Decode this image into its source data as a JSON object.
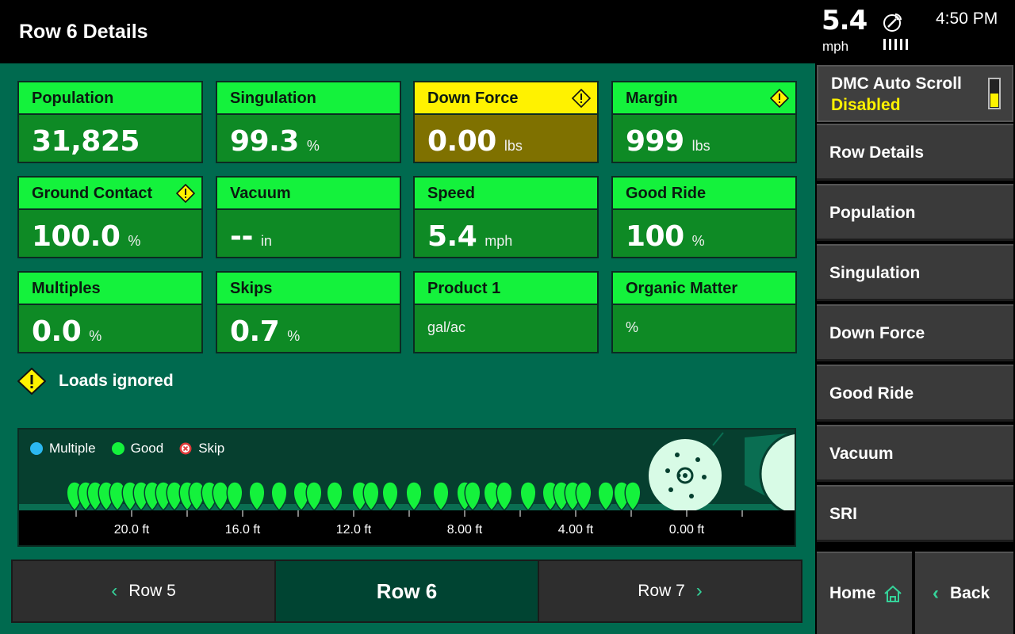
{
  "header": {
    "title": "Row 6 Details",
    "speed_value": "5.4",
    "speed_unit": "mph",
    "gps_icon": "gps-satellite-icon",
    "time": "4:50 PM"
  },
  "tiles": [
    {
      "label": "Population",
      "value": "31,825",
      "unit": "",
      "warning": false
    },
    {
      "label": "Singulation",
      "value": "99.3",
      "unit": "%",
      "warning": false
    },
    {
      "label": "Down Force",
      "value": "0.00",
      "unit": "lbs",
      "warning": true
    },
    {
      "label": "Margin",
      "value": "999",
      "unit": "lbs",
      "warning": false,
      "alert_icon": true
    },
    {
      "label": "Ground Contact",
      "value": "100.0",
      "unit": "%",
      "warning": false,
      "alert_icon": true
    },
    {
      "label": "Vacuum",
      "value": "--",
      "unit": "in",
      "warning": false
    },
    {
      "label": "Speed",
      "value": "5.4",
      "unit": "mph",
      "warning": false
    },
    {
      "label": "Good Ride",
      "value": "100",
      "unit": "%",
      "warning": false
    },
    {
      "label": "Multiples",
      "value": "0.0",
      "unit": "%",
      "warning": false
    },
    {
      "label": "Skips",
      "value": "0.7",
      "unit": "%",
      "warning": false
    },
    {
      "label": "Product 1",
      "value": "",
      "unit": "gal/ac",
      "warning": false
    },
    {
      "label": "Organic Matter",
      "value": "",
      "unit": "%",
      "warning": false
    }
  ],
  "alert": {
    "text": "Loads ignored",
    "icon": "warning-icon"
  },
  "seed_view": {
    "legend": [
      {
        "label": "Multiple",
        "color": "#2bb8f0"
      },
      {
        "label": "Good",
        "color": "#14f23c"
      },
      {
        "label": "Skip",
        "color": "#e03a3a"
      }
    ],
    "distance_labels": [
      "20.0 ft",
      "16.0 ft",
      "12.0 ft",
      "8.00 ft",
      "4.00 ft",
      "0.00 ft"
    ]
  },
  "row_nav": {
    "prev": "Row 5",
    "current": "Row 6",
    "next": "Row 7"
  },
  "sidebar": {
    "auto_scroll_title": "DMC Auto Scroll",
    "auto_scroll_status": "Disabled",
    "items": [
      "Row Details",
      "Population",
      "Singulation",
      "Down Force",
      "Good Ride",
      "Vacuum",
      "SRI"
    ],
    "home": "Home",
    "back": "Back"
  },
  "colors": {
    "accent_green": "#14f23c",
    "warning_yellow": "#fff200",
    "background": "#006a4f"
  }
}
